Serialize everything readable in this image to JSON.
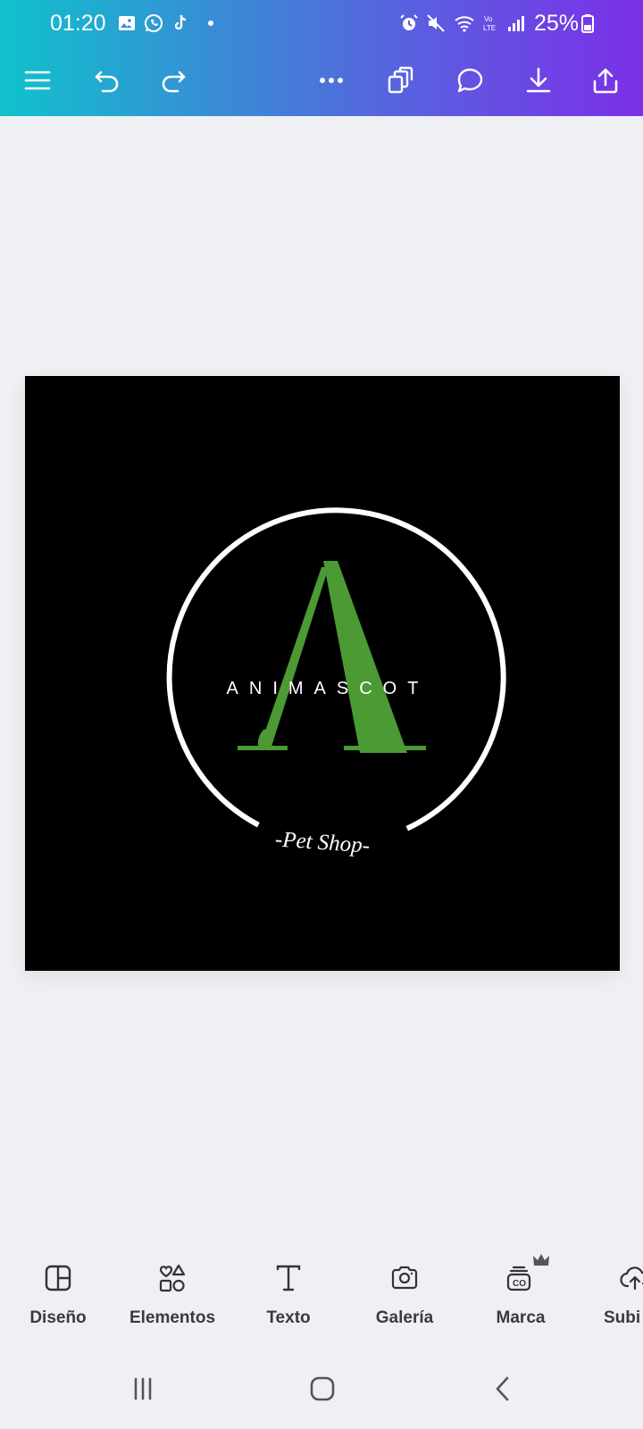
{
  "status_bar": {
    "time": "01:20",
    "battery": "25%",
    "icons": [
      "gallery-icon",
      "whatsapp-icon",
      "tiktok-icon",
      "dot-icon",
      "alarm-icon",
      "mute-icon",
      "wifi-icon",
      "volte-icon",
      "signal-icon",
      "battery-icon"
    ]
  },
  "toolbar": {
    "icons": [
      "menu-icon",
      "undo-icon",
      "redo-icon",
      "more-icon",
      "pages-icon",
      "comment-icon",
      "download-icon",
      "share-icon"
    ]
  },
  "design": {
    "brand": "ANIMASCOT",
    "tagline": "-Pet Shop-",
    "colors": {
      "background": "#000000",
      "accent": "#4b9a34",
      "ring": "#ffffff"
    }
  },
  "bottom_bar": {
    "items": [
      {
        "label": "Diseño",
        "icon": "layout-icon"
      },
      {
        "label": "Elementos",
        "icon": "shapes-icon"
      },
      {
        "label": "Texto",
        "icon": "text-icon"
      },
      {
        "label": "Galería",
        "icon": "camera-icon"
      },
      {
        "label": "Marca",
        "icon": "brand-kit-icon"
      },
      {
        "label": "Subi",
        "icon": "upload-cloud-icon"
      }
    ]
  },
  "nav_bar": {
    "icons": [
      "recent-apps-icon",
      "home-icon",
      "back-icon"
    ]
  }
}
